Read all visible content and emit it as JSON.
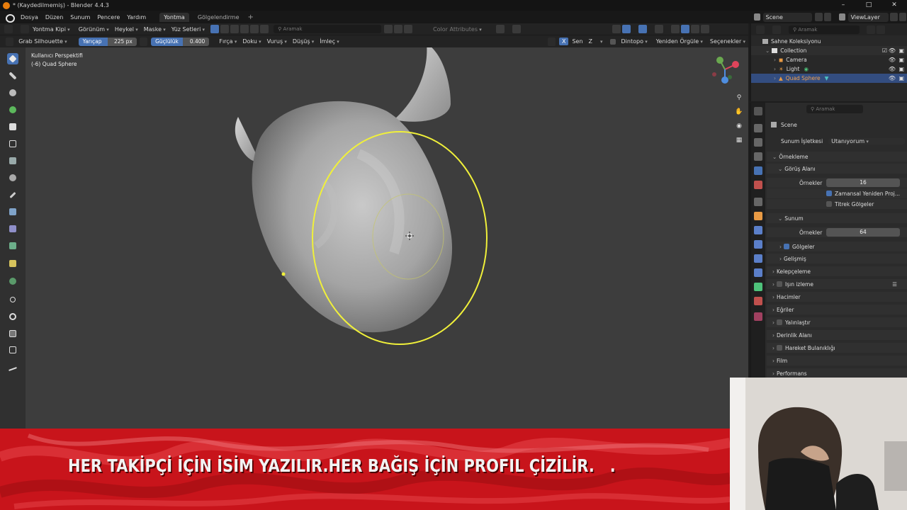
{
  "window": {
    "title": "* (Kaydedilmemiş) - Blender 4.4.3",
    "controls": [
      "–",
      "□",
      "✕"
    ]
  },
  "menu": {
    "items": [
      "Dosya",
      "Düzen",
      "Sunum",
      "Pencere",
      "Yardım"
    ],
    "workspaces": [
      "Yontma",
      "Gölgelendirme"
    ],
    "add": "+"
  },
  "topright": {
    "scene": "Scene",
    "viewlayer": "ViewLayer"
  },
  "header": {
    "mode": "Yontma Kipi",
    "menus": [
      "Görünüm",
      "Heykel",
      "Maske",
      "Yüz Setleri"
    ],
    "search_placeholder": "Aramak",
    "color_attributes": "Color Attributes"
  },
  "toolsettings": {
    "brush": "Grab Silhouette",
    "radius_label": "Yarıçap",
    "radius_value": "225 px",
    "strength_label": "Güçlülük",
    "strength_value": "0.400",
    "menus": [
      "Fırça",
      "Doku",
      "Vuruş",
      "Düşüş",
      "İmleç"
    ],
    "axis_x": "X",
    "axis_label": "Sen",
    "axis_z": "Z",
    "dyntopo": "Dintopo",
    "remesh": "Yeniden Örgüle",
    "options": "Seçenekler"
  },
  "viewport": {
    "line1": "Kullanıcı Perspektifi",
    "line2": "(-6) Quad Sphere"
  },
  "outliner": {
    "search_placeholder": "Aramak",
    "root": "Sahne Koleksiyonu",
    "collection": "Collection",
    "items": [
      "Camera",
      "Light",
      "Quad Sphere"
    ]
  },
  "properties": {
    "search_placeholder": "Aramak",
    "scene": "Scene",
    "engine_label": "Sunum İşletkesi",
    "engine_value": "Utanıyorum",
    "sampling": "Örnekleme",
    "viewport_section": "Görüş Alanı",
    "samples_label": "Örnekler",
    "viewport_samples": "16",
    "temporal_reprojection": "Zamansal Yeniden Proj...",
    "jitter_shadows": "Titrek Gölgeler",
    "render_section": "Sunum",
    "render_samples": "64",
    "shadows": "Gölgeler",
    "advanced": "Gelişmiş",
    "clamping": "Kelepçeleme",
    "raytracing": "Işın izleme",
    "volumes": "Hacimler",
    "curves": "Eğriler",
    "simplify": "Yalınlaştır",
    "dof": "Derinlik Alanı",
    "motion_blur": "Hareket Bulanıklığı",
    "film": "Film",
    "performance": "Performans"
  },
  "banner": {
    "text": "HER TAKİPÇİ İÇİN İSİM YAZILIR.HER BAĞIŞ İÇİN PROFIL ÇİZİLİR.",
    "dot": "."
  },
  "colors": {
    "accent": "#4772b3",
    "brush_circle": "#f0f03a",
    "banner": "#c8141b"
  }
}
